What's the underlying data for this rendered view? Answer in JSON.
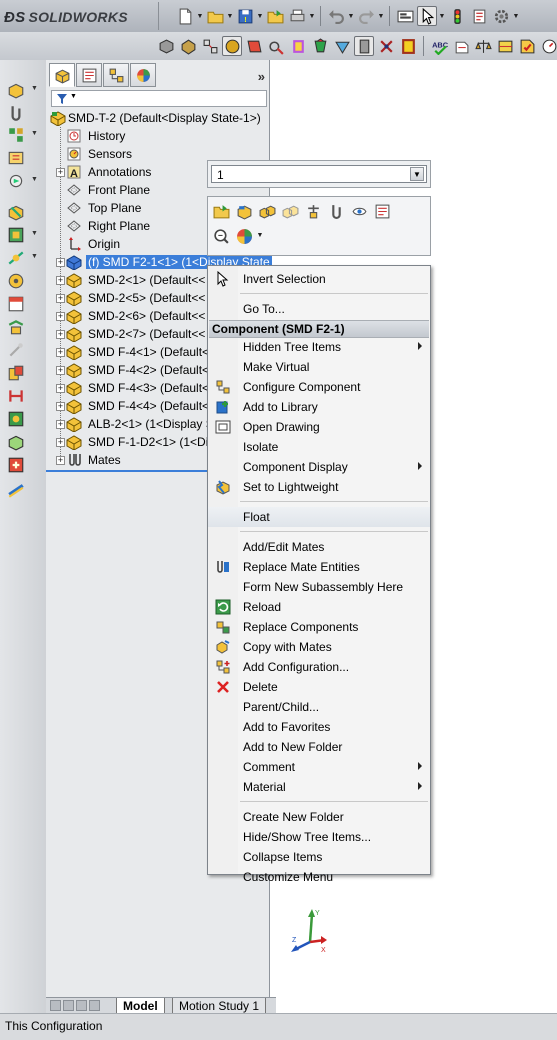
{
  "app": {
    "name": "SOLIDWORKS"
  },
  "feature_tree": {
    "root": "SMD-T-2  (Default<Display State-1>)",
    "items": [
      {
        "label": "History",
        "icon": "history-icon"
      },
      {
        "label": "Sensors",
        "icon": "sensors-icon"
      },
      {
        "label": "Annotations",
        "icon": "annotations-icon",
        "expandable": true
      },
      {
        "label": "Front Plane",
        "icon": "plane-icon"
      },
      {
        "label": "Top Plane",
        "icon": "plane-icon"
      },
      {
        "label": "Right Plane",
        "icon": "plane-icon"
      },
      {
        "label": "Origin",
        "icon": "origin-icon"
      },
      {
        "label": "(f) SMD F2-1<1> (1<Display State",
        "icon": "part-icon",
        "selected": true,
        "expandable": true
      },
      {
        "label": "SMD-2<1> (Default<<",
        "icon": "part-icon",
        "expandable": true
      },
      {
        "label": "SMD-2<5> (Default<<",
        "icon": "part-icon",
        "expandable": true
      },
      {
        "label": "SMD-2<6> (Default<<",
        "icon": "part-icon",
        "expandable": true
      },
      {
        "label": "SMD-2<7> (Default<<",
        "icon": "part-icon",
        "expandable": true
      },
      {
        "label": "SMD F-4<1> (Default<",
        "icon": "part-icon",
        "expandable": true
      },
      {
        "label": "SMD F-4<2> (Default<",
        "icon": "part-icon",
        "expandable": true
      },
      {
        "label": "SMD F-4<3> (Default<",
        "icon": "part-icon",
        "expandable": true
      },
      {
        "label": "SMD F-4<4> (Default<",
        "icon": "part-icon",
        "expandable": true
      },
      {
        "label": "ALB-2<1> (1<Display S",
        "icon": "part-icon",
        "expandable": true
      },
      {
        "label": "SMD F-1-D2<1> (1<Di",
        "icon": "part-icon",
        "expandable": true
      },
      {
        "label": "Mates",
        "icon": "mates-icon",
        "expandable": true
      }
    ]
  },
  "config_dropdown": {
    "value": "1"
  },
  "context_menu": {
    "items": [
      {
        "label": "Invert Selection",
        "icon": "cursor-icon"
      },
      {
        "sep": true
      },
      {
        "label": "Go To..."
      },
      {
        "header": "Component (SMD F2-1)"
      },
      {
        "label": "Hidden Tree Items",
        "submenu": true
      },
      {
        "label": "Make Virtual"
      },
      {
        "label": "Configure Component",
        "icon": "configure-component-icon"
      },
      {
        "label": "Add to Library",
        "icon": "add-to-library-icon"
      },
      {
        "label": "Open Drawing",
        "icon": "open-drawing-icon"
      },
      {
        "label": "Isolate"
      },
      {
        "label": "Component Display",
        "submenu": true
      },
      {
        "label": "Set to Lightweight",
        "icon": "lightweight-icon"
      },
      {
        "sep": true
      },
      {
        "label": "Float",
        "highlighted": true
      },
      {
        "sep": true
      },
      {
        "label": "Add/Edit Mates"
      },
      {
        "label": "Replace Mate Entities",
        "icon": "replace-mate-icon"
      },
      {
        "label": "Form New Subassembly Here"
      },
      {
        "label": "Reload",
        "icon": "reload-icon"
      },
      {
        "label": "Replace Components",
        "icon": "replace-components-icon"
      },
      {
        "label": "Copy with Mates",
        "icon": "copy-mates-icon"
      },
      {
        "label": "Add Configuration...",
        "icon": "add-configuration-icon"
      },
      {
        "label": "Delete",
        "icon": "delete-icon"
      },
      {
        "label": "Parent/Child..."
      },
      {
        "label": "Add to Favorites"
      },
      {
        "label": "Add to New Folder"
      },
      {
        "label": "Comment",
        "submenu": true
      },
      {
        "label": "Material",
        "submenu": true
      },
      {
        "sep": true
      },
      {
        "label": "Create New Folder"
      },
      {
        "label": "Hide/Show Tree Items..."
      },
      {
        "label": "Collapse Items"
      },
      {
        "label": "Customize Menu"
      }
    ]
  },
  "bottom_tabs": {
    "model": "Model",
    "motion": "Motion Study 1"
  },
  "status": {
    "text": "This Configuration"
  }
}
